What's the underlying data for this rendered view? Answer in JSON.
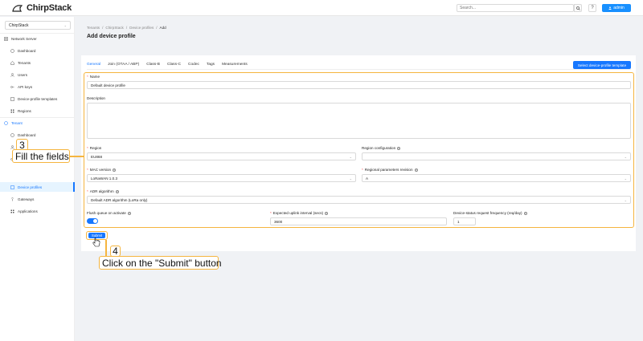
{
  "app": {
    "logo_text": "ChirpStack"
  },
  "topbar": {
    "search_placeholder": "Search...",
    "help_label": "?",
    "user_label": "admin"
  },
  "sidebar": {
    "tenant_select": "ChirpStack",
    "network_server_label": "Network Server",
    "network_items": [
      "Dashboard",
      "Tenants",
      "Users",
      "API keys",
      "Device-profile templates",
      "Regions"
    ],
    "tenant_label": "Tenant",
    "tenant_items": [
      "Dashboard",
      "",
      "",
      "Device profiles",
      "Gateways",
      "Applications"
    ]
  },
  "breadcrumb": [
    "Tenants",
    "/",
    "ChirpStack",
    "/",
    "Device profiles",
    "/",
    "Add"
  ],
  "page_title": "Add device profile",
  "tabs": [
    "General",
    "Join (OTAA / ABP)",
    "Class-B",
    "Class-C",
    "Codec",
    "Tags",
    "Measurements"
  ],
  "template_button": "Select device-profile template",
  "form": {
    "name_label": "Name",
    "name_value": "Default device profile",
    "description_label": "Description",
    "region_label": "Region",
    "region_value": "EU868",
    "region_config_label": "Region configuration",
    "mac_label": "MAC version",
    "mac_value": "LoRaWAN 1.0.3",
    "regparams_label": "Regional parameters revision",
    "regparams_value": "A",
    "adr_label": "ADR algorithm",
    "adr_value": "Default ADR algorithm (LoRa only)",
    "flush_label": "Flush queue on activate",
    "uplink_label": "Expected uplink interval (secs)",
    "uplink_value": "3600",
    "devstatus_label": "Device-status request frequency (req/day)",
    "devstatus_value": "1",
    "required_mark": "*",
    "submit_label": "Submit"
  },
  "callouts": {
    "step3_num": "3",
    "step3_text": "Fill the fields",
    "step4_num": "4",
    "step4_text": "Click on the \"Submit\" button"
  },
  "colors": {
    "accent": "#1677ff",
    "highlight": "#f5b53f"
  }
}
